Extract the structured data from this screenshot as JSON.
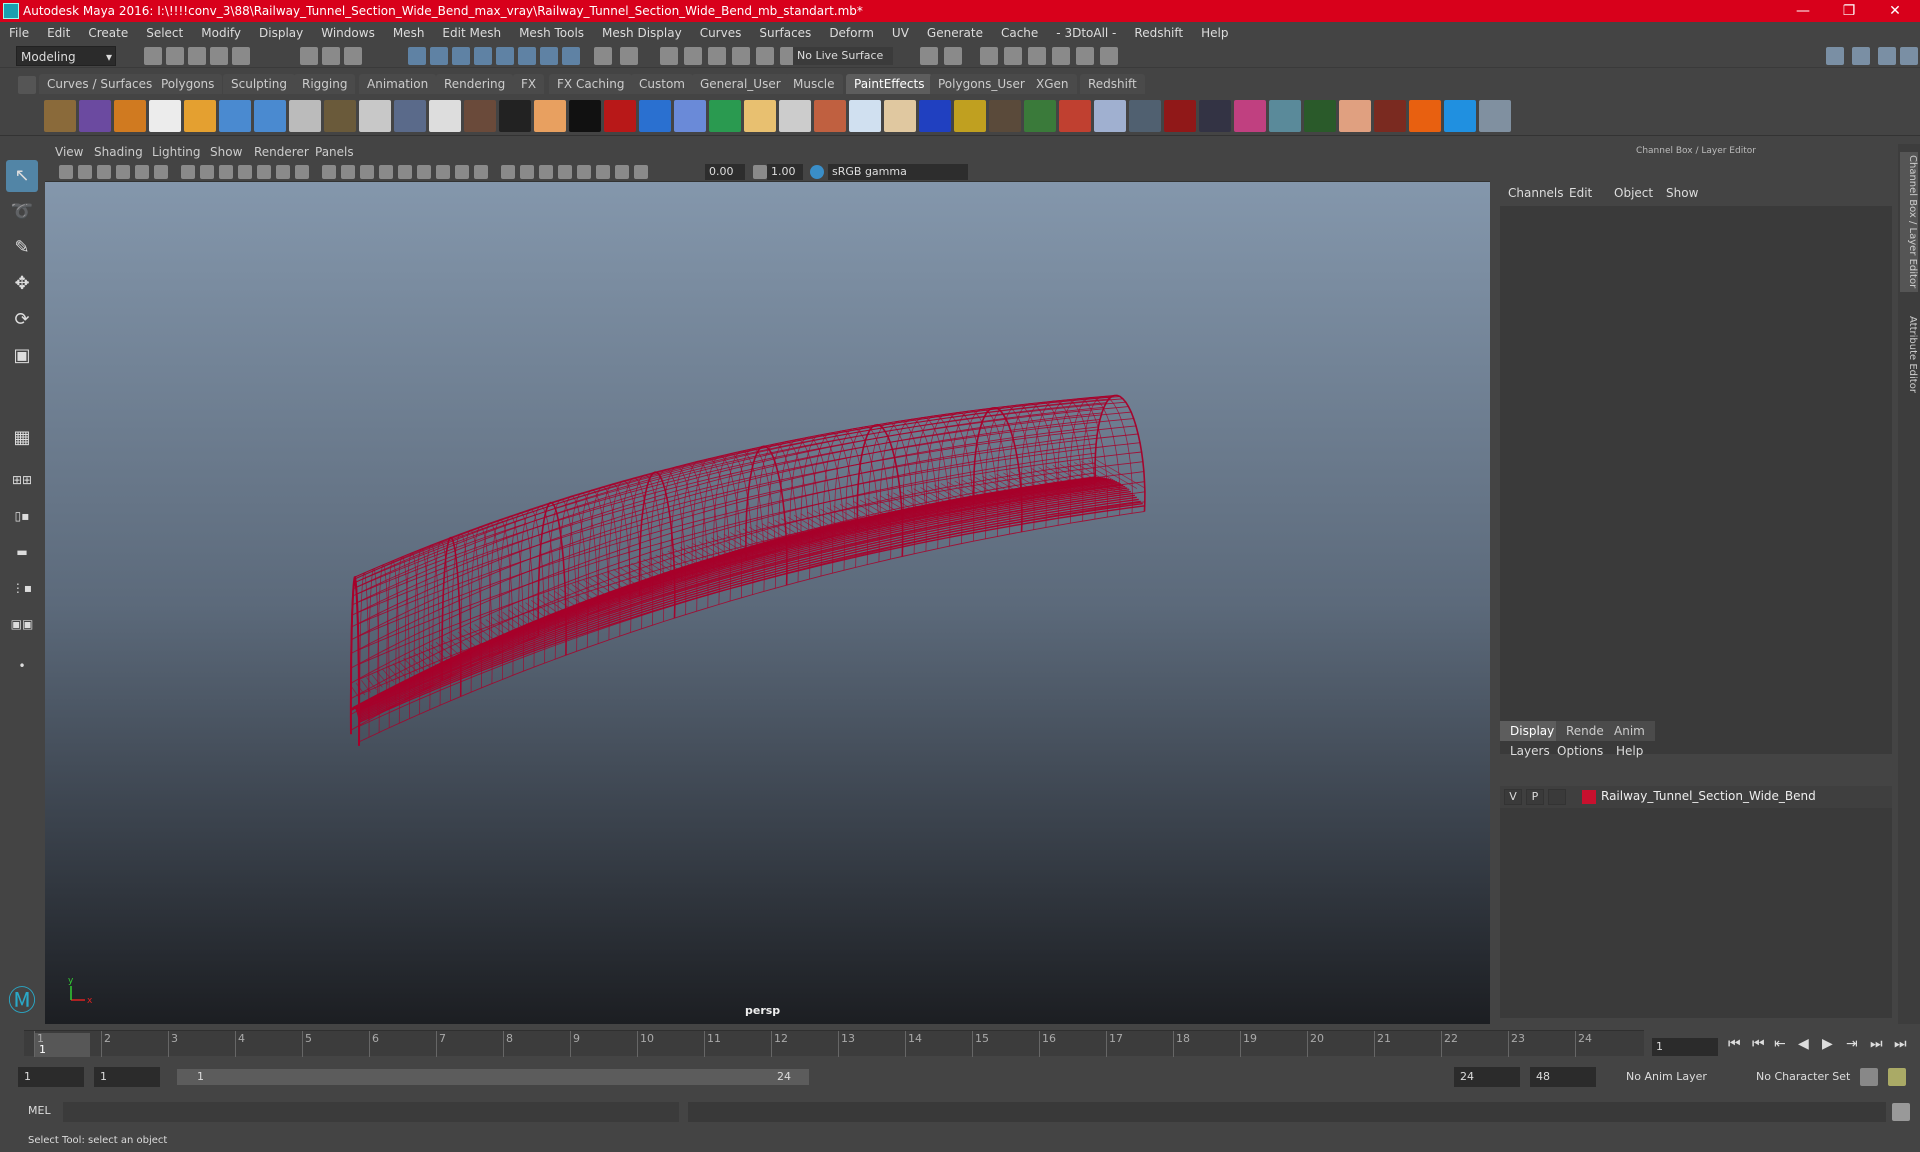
{
  "window": {
    "title": "Autodesk Maya 2016: I:\\!!!!conv_3\\88\\Railway_Tunnel_Section_Wide_Bend_max_vray\\Railway_Tunnel_Section_Wide_Bend_mb_standart.mb*",
    "minimize": "—",
    "maximize": "❐",
    "close": "✕",
    "accent": "#d8001b"
  },
  "menubar": [
    "File",
    "Edit",
    "Create",
    "Select",
    "Modify",
    "Display",
    "Windows",
    "Mesh",
    "Edit Mesh",
    "Mesh Tools",
    "Mesh Display",
    "Curves",
    "Surfaces",
    "Deform",
    "UV",
    "Generate",
    "Cache",
    "- 3DtoAll -",
    "Redshift",
    "Help"
  ],
  "statusline": {
    "mode": "Modeling",
    "dropdown_arrow": "▾",
    "live_surface": "No Live Surface"
  },
  "shelf": {
    "tabs": [
      "Curves / Surfaces",
      "Polygons",
      "Sculpting",
      "Rigging",
      "Animation",
      "Rendering",
      "FX",
      "FX Caching",
      "Custom",
      "General_User",
      "Muscle",
      "PaintEffects",
      "Polygons_User",
      "XGen",
      "Redshift"
    ],
    "active_tab": "PaintEffects"
  },
  "viewport": {
    "menu": [
      "View",
      "Shading",
      "Lighting",
      "Show",
      "Renderer",
      "Panels"
    ],
    "exposure": "0.00",
    "gamma": "1.00",
    "color_space": "sRGB gamma",
    "camera": "persp",
    "wire_color": "#a8002a",
    "axis_y": "y",
    "axis_x": "x"
  },
  "channel_box": {
    "title": "Channel Box / Layer Editor",
    "menu": [
      "Channels",
      "Edit",
      "Object",
      "Show"
    ]
  },
  "layer_editor": {
    "tabs": [
      "Display",
      "Render",
      "Anim"
    ],
    "active_tab": "Display",
    "menu": [
      "Layers",
      "Options",
      "Help"
    ],
    "layers": [
      {
        "visible": "V",
        "playback": "P",
        "color": "#c8102e",
        "name": "Railway_Tunnel_Section_Wide_Bend"
      }
    ]
  },
  "side_tabs": [
    "Channel Box / Layer Editor",
    "Attribute Editor"
  ],
  "timeline": {
    "ticks": [
      "1",
      "2",
      "3",
      "4",
      "5",
      "6",
      "7",
      "8",
      "9",
      "10",
      "11",
      "12",
      "13",
      "14",
      "15",
      "16",
      "17",
      "18",
      "19",
      "20",
      "21",
      "22",
      "23",
      "24"
    ],
    "current_frame": "1",
    "frame_field": "1"
  },
  "playback_buttons": [
    "⏮",
    "⏮",
    "⇤",
    "◀",
    "▶",
    "⇥",
    "⏭",
    "⏭"
  ],
  "range": {
    "start": "1",
    "playback_start": "1",
    "slider_start": "1",
    "slider_end": "24",
    "playback_end": "24",
    "end": "48",
    "anim_layer": "No Anim Layer",
    "character_set": "No Character Set"
  },
  "command_line": {
    "label": "MEL"
  },
  "help_line": "Select Tool: select an object"
}
